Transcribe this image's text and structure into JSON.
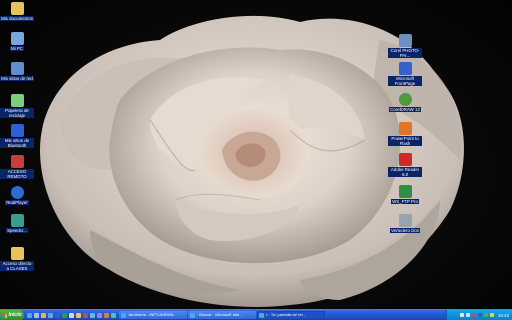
{
  "desktop": {
    "left_icons": [
      {
        "name": "mis-documentos",
        "label": "Mis documentos",
        "icon": "folder-documents-icon",
        "color": "#e8c35a"
      },
      {
        "name": "mi-pc",
        "label": "Mi PC",
        "icon": "computer-icon",
        "color": "#7aa7d8"
      },
      {
        "name": "mis-sitios-de-red",
        "label": "Mis sitios de red",
        "icon": "network-icon",
        "color": "#5f8fd0"
      },
      {
        "name": "papelera-de-reciclaje",
        "label": "Papelera de reciclaje",
        "icon": "recycle-bin-icon",
        "color": "#7ccf7a"
      },
      {
        "name": "mis-sitios-bluetooth",
        "label": "Mis sitios de Bluetooth",
        "icon": "bluetooth-icon",
        "color": "#2f5fd6"
      },
      {
        "name": "acceso-remoto",
        "label": "ACCESO REMOTO",
        "icon": "remote-access-icon",
        "color": "#c93c3c"
      },
      {
        "name": "realplayer",
        "label": "RealPlayer",
        "icon": "realplayer-icon",
        "color": "#2d6bd6"
      },
      {
        "name": "speedcrunch",
        "label": "Speedcr...",
        "icon": "calculator-icon",
        "color": "#3a9e8c"
      },
      {
        "name": "acceso-clases",
        "label": "Acceso directo a CLASES",
        "icon": "folder-shortcut-icon",
        "color": "#e8c35a"
      }
    ],
    "right_icons": [
      {
        "name": "corel-photo-paint",
        "label": "Corel PHOTO-PAI...",
        "icon": "corel-photopaint-icon",
        "color": "#6c8fc4"
      },
      {
        "name": "microsoft-frontpage",
        "label": "Microsoft FrontPage",
        "icon": "frontpage-icon",
        "color": "#3561c9"
      },
      {
        "name": "coreldraw-12",
        "label": "CorelDRAW 12",
        "icon": "coreldraw-icon",
        "color": "#4f9a3c"
      },
      {
        "name": "powerpoint-to-flash",
        "label": "PowerPoint to Flash",
        "icon": "powerpoint-flash-icon",
        "color": "#e2742a"
      },
      {
        "name": "adobe-reader",
        "label": "Adobe Reader 6.0",
        "icon": "adobe-reader-icon",
        "color": "#cf2a2a"
      },
      {
        "name": "ws-ftp-pro",
        "label": "WS_FTP Pro",
        "icon": "ws-ftp-icon",
        "color": "#2f8f47"
      },
      {
        "name": "vertedero-dos",
        "label": "Vertedero Dos",
        "icon": "trash-icon",
        "color": "#9aa3ad"
      }
    ]
  },
  "taskbar": {
    "start_label": "Inicio",
    "quicklaunch": [
      {
        "name": "ql-ie-icon",
        "color": "#4ea7e8"
      },
      {
        "name": "ql-desktop-icon",
        "color": "#9cc4ee"
      },
      {
        "name": "ql-media-icon",
        "color": "#e6b53a"
      },
      {
        "name": "ql-outlook-icon",
        "color": "#6aa0e0"
      },
      {
        "name": "ql-word-icon",
        "color": "#2e62c9"
      },
      {
        "name": "ql-excel-icon",
        "color": "#2e9b47"
      },
      {
        "name": "ql-app-icon",
        "color": "#d9d9d9"
      },
      {
        "name": "ql-app2-icon",
        "color": "#f2c94c"
      },
      {
        "name": "ql-app3-icon",
        "color": "#c94a4a"
      },
      {
        "name": "ql-app4-icon",
        "color": "#6fb7e0"
      },
      {
        "name": "ql-app5-icon",
        "color": "#aa7fd6"
      },
      {
        "name": "ql-app6-icon",
        "color": "#e07a3a"
      },
      {
        "name": "ql-app7-icon",
        "color": "#58c0a0"
      }
    ],
    "tasks": [
      {
        "label": "Jardinería - INFOJARDÍN...",
        "icon": "ie-window-icon",
        "color": "#4ea7e8",
        "active": false
      },
      {
        "label": ": Buscar - Microsoft Inte...",
        "icon": "ie-window-icon",
        "color": "#4ea7e8",
        "active": false
      },
      {
        "label": "r - Tu! pantalla tu! fer...",
        "icon": "ie-window-icon",
        "color": "#4ea7e8",
        "active": true
      }
    ],
    "tray_icons": [
      {
        "name": "tray-volume-icon",
        "color": "#e8e8e8"
      },
      {
        "name": "tray-network-icon",
        "color": "#cfe3f7"
      },
      {
        "name": "tray-antivirus-icon",
        "color": "#e04040"
      },
      {
        "name": "tray-bluetooth-icon",
        "color": "#2f5fd6"
      },
      {
        "name": "tray-messenger-icon",
        "color": "#4fb34a"
      },
      {
        "name": "tray-update-icon",
        "color": "#f2c94c"
      }
    ],
    "clock": "19:42"
  }
}
